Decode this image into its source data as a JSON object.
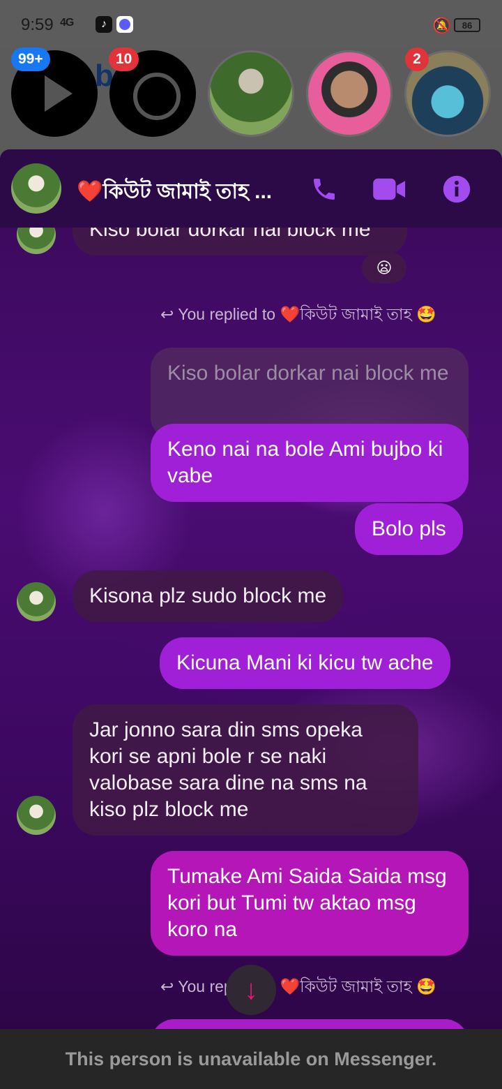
{
  "status_bar": {
    "time": "9:59",
    "network": "4G",
    "battery": "86"
  },
  "stories": {
    "badge_watch": "99+",
    "badge_messenger": "10",
    "badge_story3": "2"
  },
  "chat": {
    "contact_name": "❤️কিউট জামাই তাহ ...",
    "icons": {
      "call": "phone-icon",
      "video": "video-camera-icon",
      "info": "info-icon"
    },
    "accent_color": "#a020d8",
    "messages": [
      {
        "side": "in",
        "text": "Kiso bolar dorkar nai block me",
        "reaction": "😦"
      },
      {
        "type": "reply_note",
        "text": "You replied to ❤️কিউট জামাই তাহ 🤩"
      },
      {
        "side": "quoted",
        "text": "Kiso bolar dorkar nai block me"
      },
      {
        "side": "out",
        "text": "Keno nai na bole Ami bujbo ki vabe"
      },
      {
        "side": "out",
        "text": "Bolo pls"
      },
      {
        "side": "in",
        "text": "Kisona plz sudo block me"
      },
      {
        "side": "out",
        "text": "Kicuna Mani ki kicu tw ache"
      },
      {
        "side": "in",
        "text": "Jar jonno sara din sms opeka kori se apni bole r se naki valobase sara dine na sms na kiso plz block me"
      },
      {
        "side": "out",
        "text": "Tumake Ami Saida Saida msg kori but Tumi tw aktao msg koro na"
      },
      {
        "type": "reply_note",
        "text": "You replied to ❤️কিউট জামাই তাহ 🤩"
      }
    ]
  },
  "footer": {
    "notice": "This person is unavailable on Messenger."
  }
}
